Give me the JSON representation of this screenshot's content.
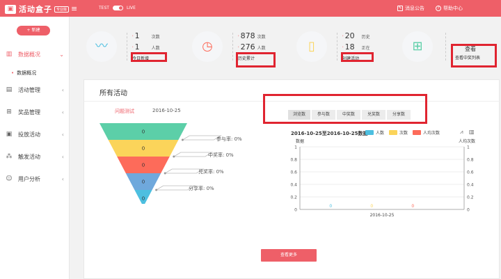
{
  "header": {
    "brand": "活动盒子",
    "brand_badge": "专业版",
    "env_left": "TEST",
    "env_right": "LIVE",
    "notice": "消息公告",
    "help": "帮助中心"
  },
  "sidebar": {
    "new_button": "+ 新建",
    "items": [
      {
        "label": "数据概况",
        "icon": "chart-icon"
      },
      {
        "label": "活动管理",
        "icon": "document-icon"
      },
      {
        "label": "奖品管理",
        "icon": "gift-icon"
      },
      {
        "label": "投放活动",
        "icon": "image-icon"
      },
      {
        "label": "触发活动",
        "icon": "network-icon"
      },
      {
        "label": "用户分析",
        "icon": "user-icon"
      }
    ],
    "sub_item": "数据概况"
  },
  "stats": {
    "today": {
      "num1": "1",
      "unit1": "次数",
      "num2": "1",
      "unit2": "人数",
      "caption": "今日新增"
    },
    "history": {
      "num1": "878",
      "unit1": "次数",
      "num2": "276",
      "unit2": "人数",
      "caption": "历史累计"
    },
    "created": {
      "num1": "20",
      "unit1": "历史",
      "num2": "18",
      "unit2": "正在",
      "caption": "创建活动"
    },
    "winners": {
      "label": "查看",
      "caption": "查看中奖列表"
    }
  },
  "panel": {
    "title": "所有活动",
    "activity_tag": "问题测试",
    "date": "2016-10-25",
    "more_button": "查看更多",
    "funnel": {
      "values": [
        "0",
        "0",
        "0",
        "0",
        "0"
      ],
      "colors": [
        "#5ccfa8",
        "#fbd45a",
        "#fd6b5a",
        "#6fa8dc",
        "#4dbfe0"
      ],
      "rates": [
        "参与率: 0%",
        "中奖率: 0%",
        "兑奖率: 0%",
        "分享率: 0%"
      ]
    },
    "tabs": [
      "浏览数",
      "参与数",
      "中奖数",
      "兑奖数",
      "分享数"
    ]
  },
  "chart_data": {
    "type": "bar",
    "title": "2016-10-25至2016-10-25数据",
    "categories": [
      "2016-10-25"
    ],
    "series": [
      {
        "name": "人数",
        "values": [
          0
        ],
        "color": "#4dbfe0"
      },
      {
        "name": "次数",
        "values": [
          0
        ],
        "color": "#fbd45a"
      },
      {
        "name": "人均次数",
        "values": [
          0
        ],
        "color": "#fd6b5a"
      }
    ],
    "ylabel_left": "数据",
    "ylabel_right": "人均次数",
    "ylim": [
      0,
      1
    ],
    "yticks": [
      "1",
      "0.8",
      "0.6",
      "0.4",
      "0.2",
      "0"
    ],
    "data_labels": [
      "0",
      "0",
      "0"
    ],
    "legend_position": "top"
  }
}
